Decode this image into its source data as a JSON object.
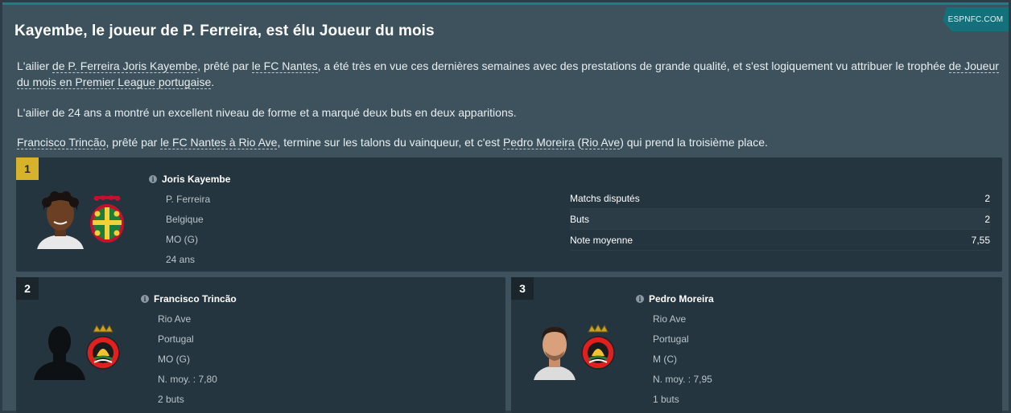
{
  "source_badge": "ESPNFC.COM",
  "headline": "Kayembe, le joueur de P. Ferreira, est élu Joueur du mois",
  "paragraph1": {
    "t1": "L'ailier ",
    "l1": "de P. Ferreira Joris Kayembe",
    "t2": ", prêté par ",
    "l2": "le FC Nantes",
    "t3": ", a été très en vue ces dernières semaines avec des prestations de grande qualité, et s'est logiquement vu attribuer le trophée ",
    "l3": "de Joueur du mois en Premier League portugaise",
    "t4": "."
  },
  "paragraph2": "L'ailier de 24 ans a montré un excellent niveau de forme et a marqué deux buts en deux apparitions.",
  "paragraph3": {
    "l1": "Francisco Trincão",
    "t1": ", prêté par ",
    "l2": "le FC Nantes à Rio Ave",
    "t2": ", termine sur les talons du vainqueur, et c'est ",
    "l3": "Pedro Moreira",
    "t3": " (",
    "l4": "Rio Ave",
    "t4": ") qui prend la troisième place."
  },
  "winner": {
    "rank": "1",
    "name": "Joris Kayembe",
    "club": "P. Ferreira",
    "nationality": "Belgique",
    "position": "MO (G)",
    "age": "24 ans",
    "stats": [
      {
        "label": "Matchs disputés",
        "value": "2"
      },
      {
        "label": "Buts",
        "value": "2"
      },
      {
        "label": "Note moyenne",
        "value": "7,55"
      }
    ]
  },
  "second": {
    "rank": "2",
    "name": "Francisco Trincão",
    "club": "Rio Ave",
    "nationality": "Portugal",
    "position": "MO (G)",
    "rating": "N. moy. : 7,80",
    "goals": "2 buts"
  },
  "third": {
    "rank": "3",
    "name": "Pedro Moreira",
    "club": "Rio Ave",
    "nationality": "Portugal",
    "position": "M (C)",
    "rating": "N. moy. : 7,95",
    "goals": "1 buts"
  },
  "colors": {
    "accent": "#1d7f80",
    "gold_rank": "#d7b22b",
    "panel": "#3d525c",
    "card": "#25353f"
  }
}
